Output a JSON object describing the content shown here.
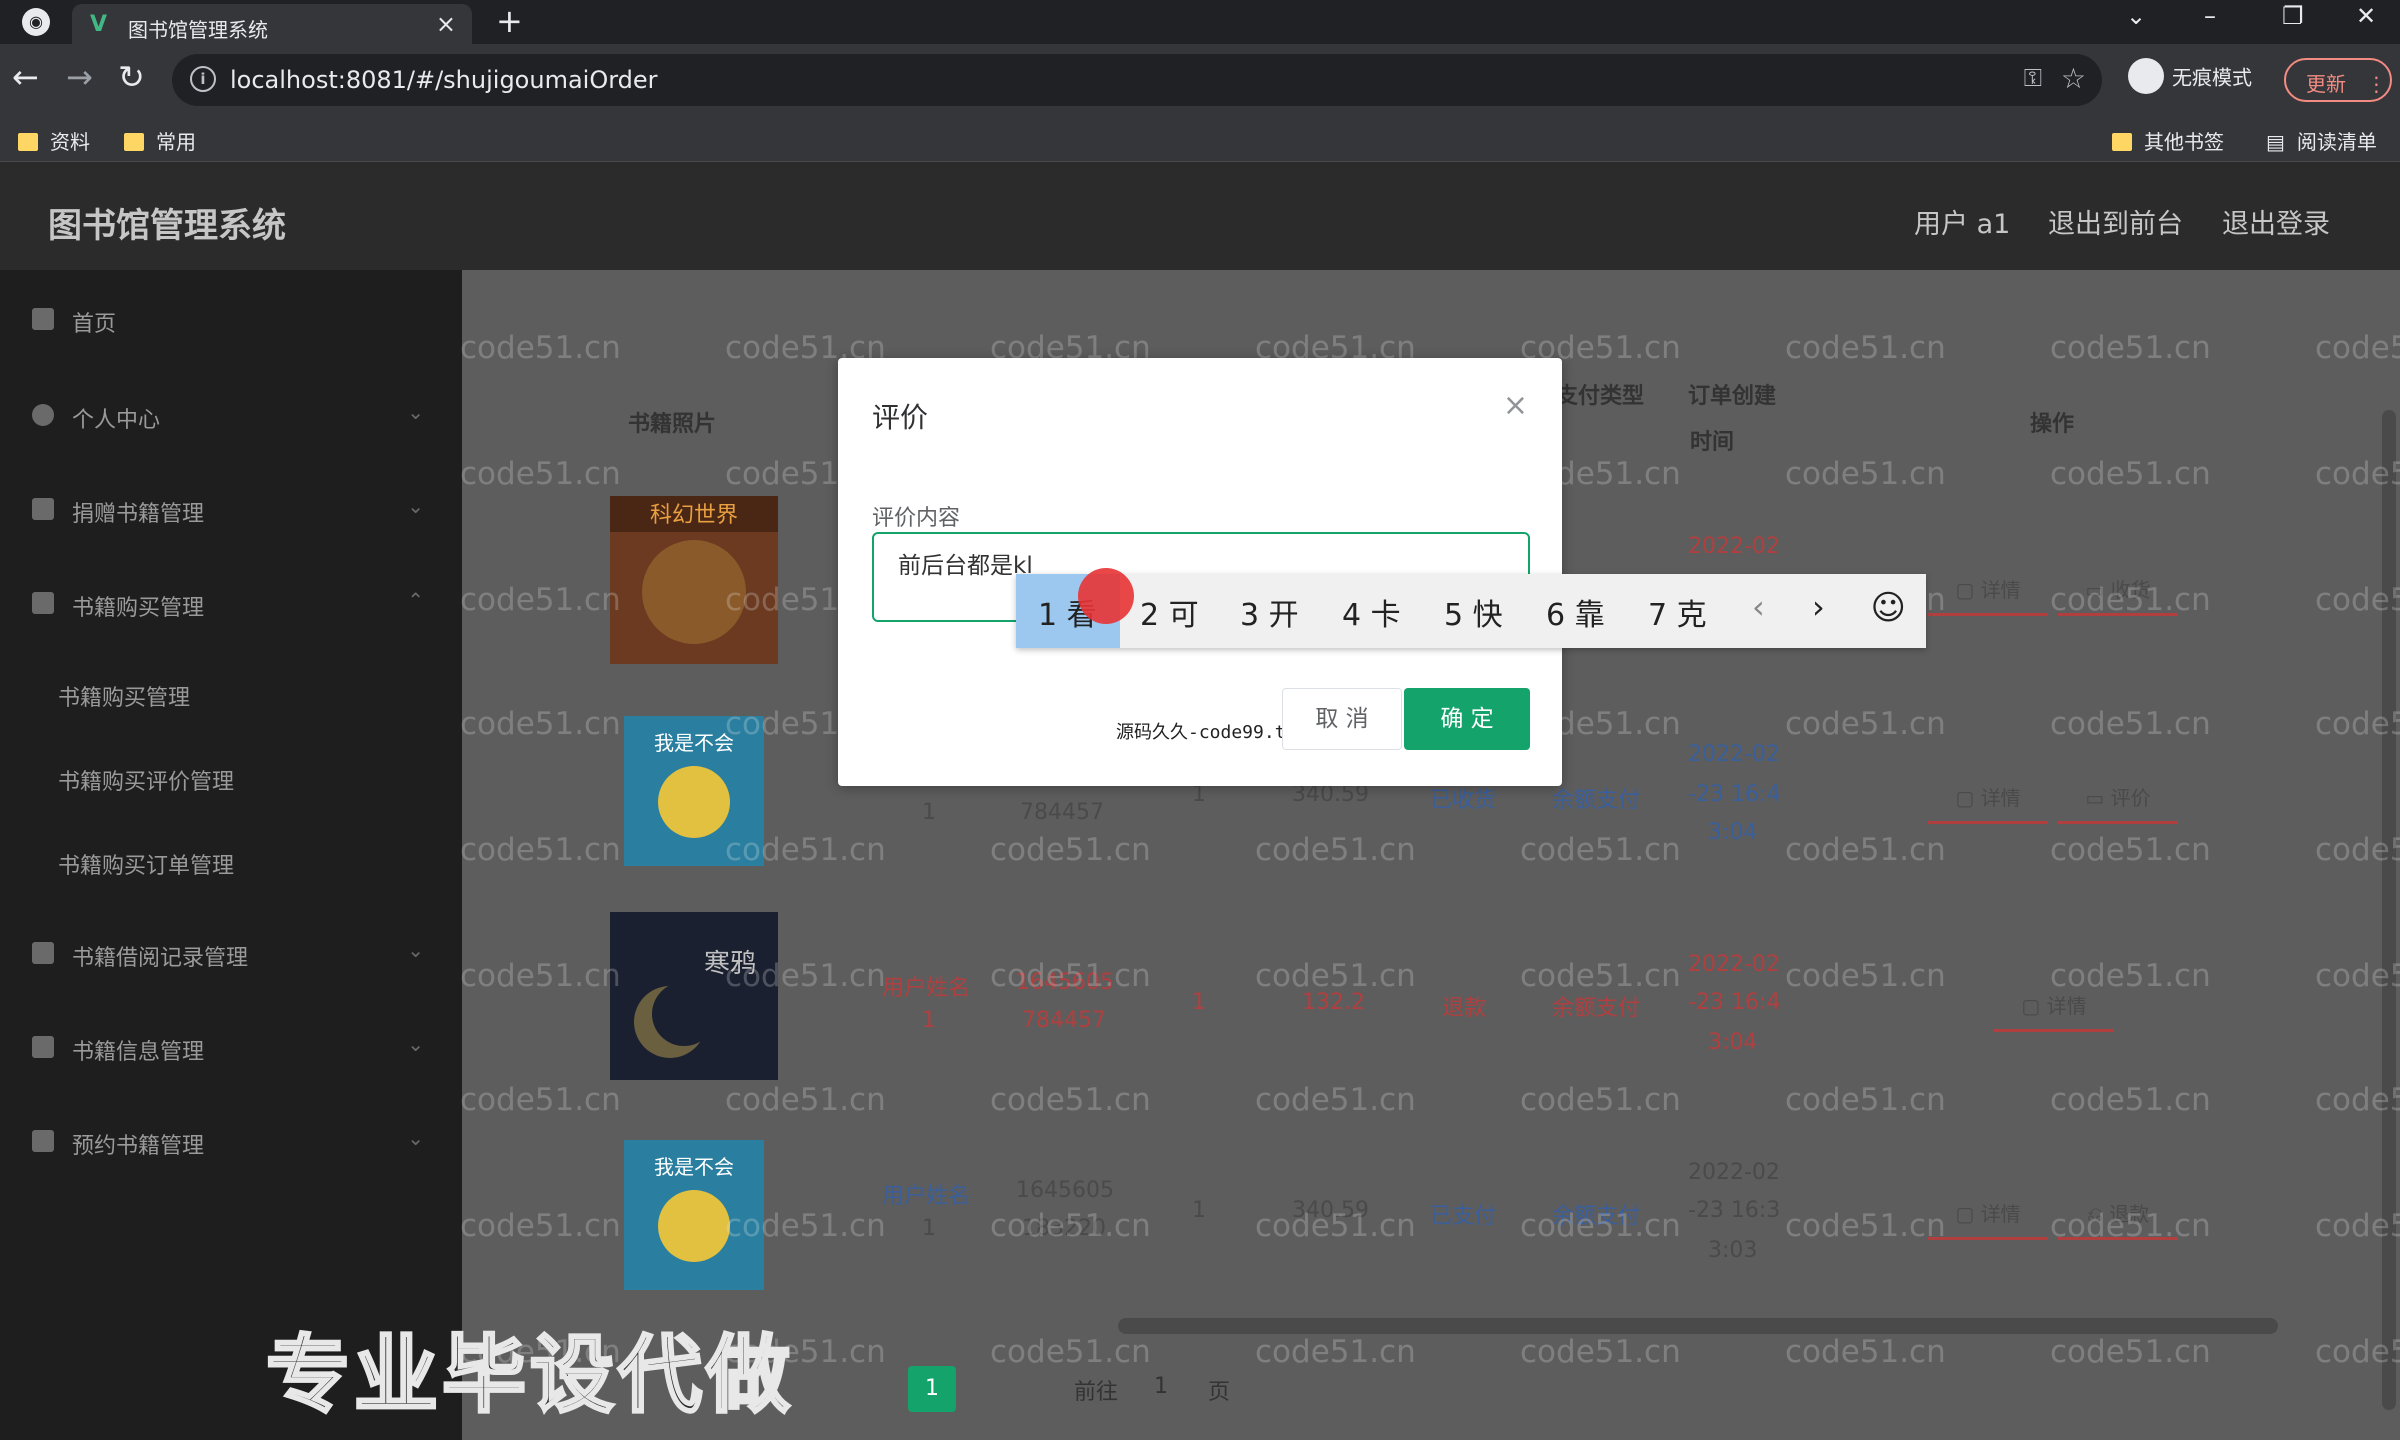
{
  "browser": {
    "tab_title": "图书馆管理系统",
    "tab_favicon": "V",
    "url": "localhost:8081/#/shujigoumaiOrder",
    "incognito_label": "无痕模式",
    "update_label": "更新",
    "bookmarks_left": [
      "资料",
      "常用"
    ],
    "bookmarks_right": [
      "其他书签",
      "阅读清单"
    ],
    "icons": [
      "chrome-icon",
      "back-arrow-icon",
      "forward-arrow-icon",
      "reload-icon",
      "info-icon",
      "key-icon",
      "star-icon",
      "incognito-icon",
      "more-vert-icon",
      "minimize-icon",
      "restore-icon",
      "close-icon"
    ]
  },
  "app": {
    "title": "图书馆管理系统",
    "user_label": "用户 a1",
    "to_front_label": "退出到前台",
    "logout_label": "退出登录"
  },
  "sidebar": {
    "items": [
      {
        "label": "首页",
        "icon": "home-icon"
      },
      {
        "label": "个人中心",
        "icon": "user-icon"
      },
      {
        "label": "捐赠书籍管理",
        "icon": "send-icon"
      },
      {
        "label": "书籍购买管理",
        "icon": "document-icon"
      }
    ],
    "sub_items": [
      "书籍购买管理",
      "书籍购买评价管理",
      "书籍购买订单管理"
    ],
    "items_after": [
      {
        "label": "书籍借阅记录管理",
        "icon": "list-icon"
      },
      {
        "label": "书籍信息管理",
        "icon": "plane-icon"
      },
      {
        "label": "预约书籍管理",
        "icon": "calendar-icon"
      }
    ]
  },
  "table": {
    "headers": {
      "photo": "书籍照片",
      "pay_type": "支付类型",
      "created_line1": "订单创建",
      "created_line2": "时间",
      "ops": "操作"
    },
    "book_titles": [
      "科幻世界",
      "我是不会",
      "寒鸦",
      "我是不会"
    ],
    "rows": [
      {
        "name": "",
        "order1": "",
        "order2": "",
        "qty": "",
        "price": "",
        "status": "",
        "pay": "",
        "date1": "2022-02",
        "date2": "",
        "date3": "",
        "ops": [
          "详情",
          "收货"
        ]
      },
      {
        "name1": "",
        "name2": "1",
        "order1": "",
        "order2": "784457",
        "qty": "1",
        "price": "340.59",
        "status": "已收货",
        "pay": "余额支付",
        "date1": "2022-02",
        "date2": "-23 16:4",
        "date3": "3:04",
        "ops": [
          "详情",
          "评价"
        ]
      },
      {
        "name1": "用户姓名",
        "name2": "1",
        "order1": "1645605",
        "order2": "784457",
        "qty": "1",
        "price": "132.2",
        "status": "退款",
        "pay": "余额支付",
        "date1": "2022-02",
        "date2": "-23 16:4",
        "date3": "3:04",
        "ops": [
          "详情"
        ]
      },
      {
        "name1": "用户姓名",
        "name2": "1",
        "order1": "1645605",
        "order2": "183220",
        "qty": "1",
        "price": "340.59",
        "status": "已支付",
        "pay": "余额支付",
        "date1": "2022-02",
        "date2": "-23 16:3",
        "date3": "3:03",
        "ops": [
          "详情",
          "退款"
        ]
      }
    ]
  },
  "pager": {
    "current": "1",
    "goto_prefix": "前往",
    "goto_value": "1",
    "goto_suffix": "页"
  },
  "dialog": {
    "title": "评价",
    "field_label": "评价内容",
    "input_value": "前后台都是kl",
    "cancel_label": "取 消",
    "confirm_label": "确 定",
    "source_text": "源码久久-code99.top"
  },
  "ime": {
    "candidates": [
      "1 看",
      "2 可",
      "3 开",
      "4 卡",
      "5 快",
      "6 靠",
      "7 克"
    ],
    "prev": "‹",
    "next": "›",
    "emoji": "☺"
  },
  "watermark_text": "code51.cn",
  "promo_text": "专业毕设代做",
  "colors": {
    "accent": "#13a36b",
    "danger": "#b04040",
    "sidebar_bg": "#1e1e1e",
    "header_bg": "#2b2b2b"
  }
}
